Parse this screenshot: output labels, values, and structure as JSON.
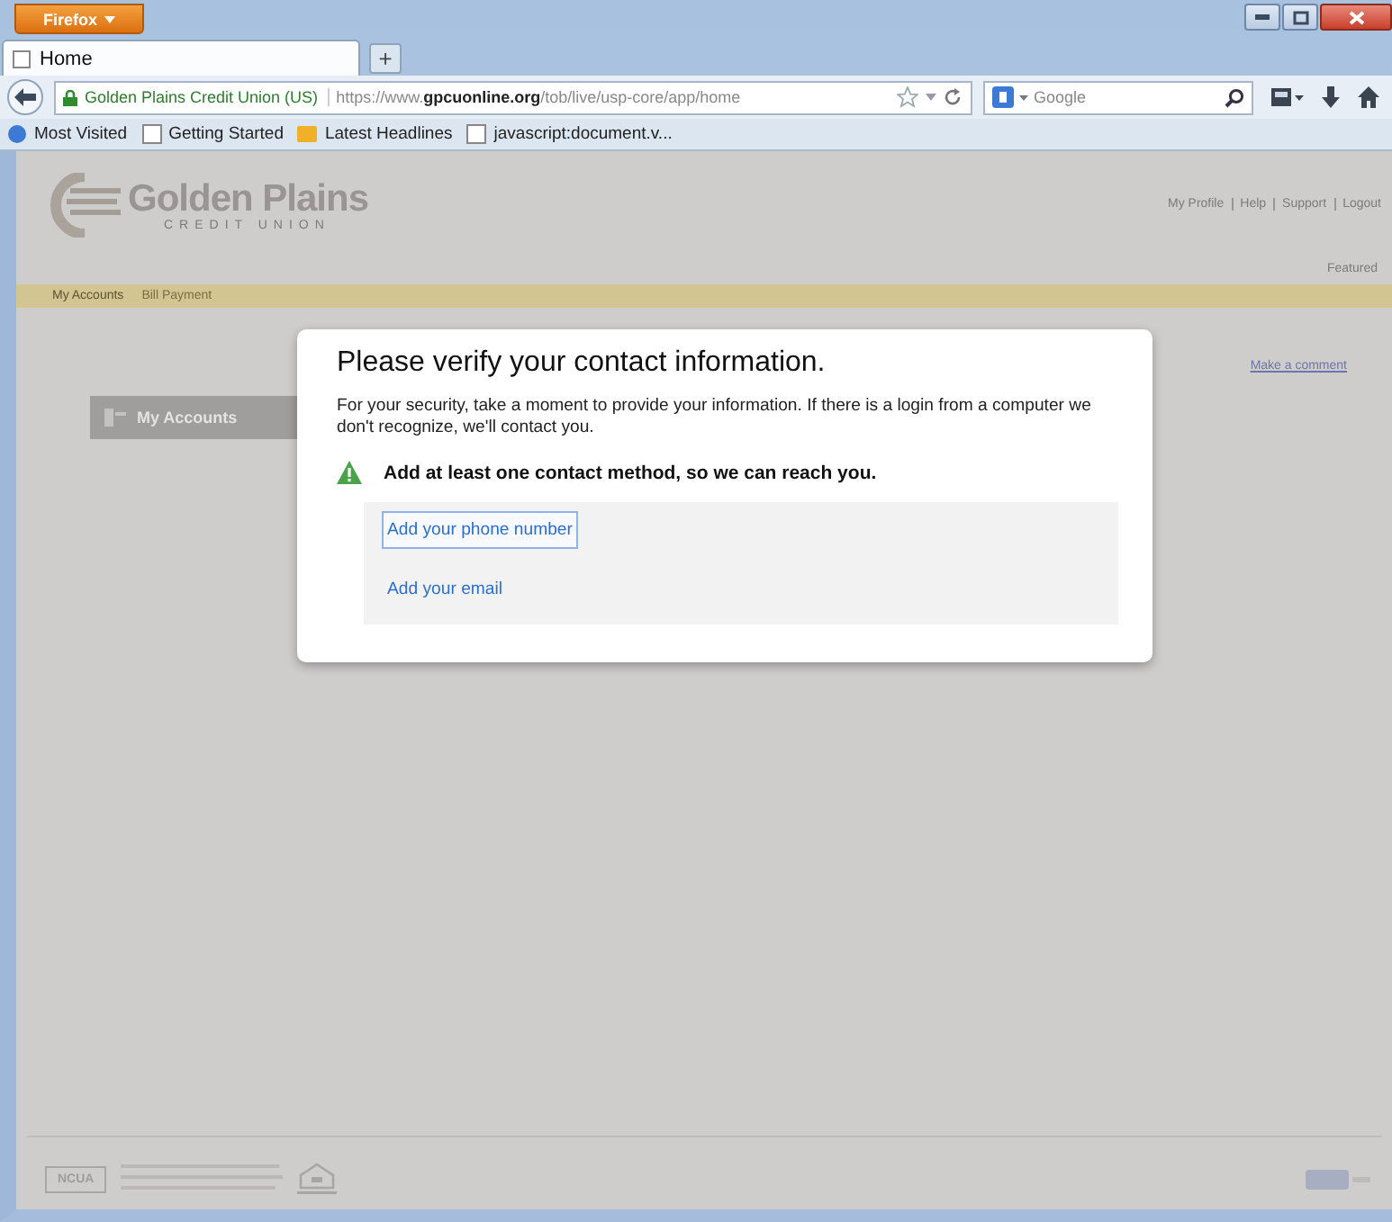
{
  "browser": {
    "menu_button": "Firefox",
    "tabs": [
      {
        "label": "Home",
        "selected": true
      }
    ],
    "new_tab": "+",
    "identity": "Golden Plains Credit Union (US)",
    "url": "https://www.**gpcuonline.org**/tob/live/usp-core/app/home",
    "search_placeholder": "Google",
    "bookmarks": [
      {
        "label": "Most Visited",
        "kind": "smart"
      },
      {
        "label": "Getting Started",
        "kind": "page"
      },
      {
        "label": "Latest Headlines",
        "kind": "feed"
      },
      {
        "label": "javascript:document.v...",
        "kind": "page"
      }
    ]
  },
  "page": {
    "logo_name": "Golden Plains",
    "logo_sub": "CREDIT UNION",
    "top_links": [
      "My Profile",
      "Help",
      "Support",
      "Logout"
    ],
    "featured": "Featured",
    "nav": [
      {
        "label": "My Accounts",
        "selected": true
      },
      {
        "label": "Bill Payment",
        "selected": false
      }
    ],
    "panel_title": "My Accounts",
    "comment_link": "Make a comment",
    "footer_badge": "NCUA"
  },
  "dialog": {
    "title": "Please verify your contact information.",
    "text": "For your security, take a moment to provide your information. If there is a login from a computer we don't recognize, we'll contact you.",
    "warning": "Add at least one contact method, so we can reach you.",
    "options": [
      {
        "label": "Add your phone number",
        "focused": true
      },
      {
        "label": "Add your email",
        "focused": false
      }
    ]
  }
}
